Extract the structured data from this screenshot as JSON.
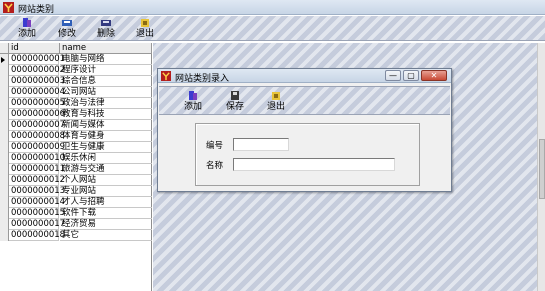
{
  "window": {
    "title": "网站类别"
  },
  "toolbar": {
    "buttons": [
      {
        "label": "添加",
        "icon": "add-icon"
      },
      {
        "label": "修改",
        "icon": "edit-icon"
      },
      {
        "label": "删除",
        "icon": "delete-icon"
      },
      {
        "label": "退出",
        "icon": "exit-icon"
      }
    ]
  },
  "grid": {
    "columns": [
      "id",
      "name"
    ],
    "rows": [
      {
        "id": "0000000001",
        "name": "电脑与网络"
      },
      {
        "id": "0000000002",
        "name": "程序设计"
      },
      {
        "id": "0000000003",
        "name": "综合信息"
      },
      {
        "id": "0000000004",
        "name": "公司网站"
      },
      {
        "id": "0000000005",
        "name": "政治与法律"
      },
      {
        "id": "0000000006",
        "name": "教育与科技"
      },
      {
        "id": "0000000007",
        "name": "新闻与媒体"
      },
      {
        "id": "0000000008",
        "name": "体育与健身"
      },
      {
        "id": "0000000009",
        "name": "卫生与健康"
      },
      {
        "id": "0000000010",
        "name": "娱乐休闲"
      },
      {
        "id": "0000000011",
        "name": "旅游与交通"
      },
      {
        "id": "0000000012",
        "name": "个人网站"
      },
      {
        "id": "0000000013",
        "name": "专业网站"
      },
      {
        "id": "0000000014",
        "name": "才人与招聘"
      },
      {
        "id": "0000000015",
        "name": "软件下载"
      },
      {
        "id": "0000000017",
        "name": "经济贸易"
      },
      {
        "id": "0000000018",
        "name": "其它"
      }
    ]
  },
  "dialog": {
    "title": "网站类别录入",
    "window_controls": [
      "—",
      "▢",
      "✕"
    ],
    "buttons": [
      {
        "label": "添加",
        "icon": "add-icon"
      },
      {
        "label": "保存",
        "icon": "save-icon"
      },
      {
        "label": "退出",
        "icon": "exit-icon"
      }
    ],
    "fields": [
      {
        "label": "编号",
        "value": ""
      },
      {
        "label": "名称",
        "value": ""
      }
    ]
  },
  "colors": {
    "hatch_dark": "#c5ccdc",
    "hatch_light": "#e2e6ee",
    "titlebar": "#c7d5e6"
  }
}
